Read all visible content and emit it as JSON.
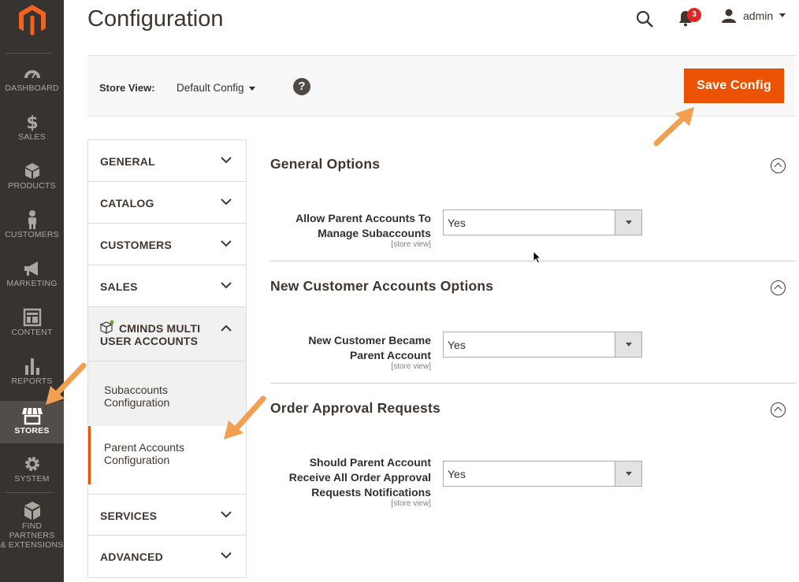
{
  "page": {
    "title": "Configuration"
  },
  "header": {
    "notifications_count": "3",
    "user_name": "admin"
  },
  "nav": {
    "items": [
      {
        "label": "DASHBOARD",
        "icon": "dashboard-icon"
      },
      {
        "label": "SALES",
        "icon": "dollar-icon"
      },
      {
        "label": "PRODUCTS",
        "icon": "box-icon"
      },
      {
        "label": "CUSTOMERS",
        "icon": "person-icon"
      },
      {
        "label": "MARKETING",
        "icon": "megaphone-icon"
      },
      {
        "label": "CONTENT",
        "icon": "content-icon"
      },
      {
        "label": "REPORTS",
        "icon": "bar-chart-icon"
      },
      {
        "label": "STORES",
        "icon": "store-icon",
        "active": true
      },
      {
        "label": "SYSTEM",
        "icon": "gear-icon"
      },
      {
        "label_line1": "FIND PARTNERS",
        "label_line2": "& EXTENSIONS",
        "icon": "blocks-icon"
      }
    ]
  },
  "store_view": {
    "label": "Store View:",
    "value": "Default Config"
  },
  "toolbar": {
    "save_label": "Save Config"
  },
  "tabs": {
    "general": "GENERAL",
    "catalog": "CATALOG",
    "customers": "CUSTOMERS",
    "sales": "SALES",
    "cminds_line1": "CMINDS MULTI",
    "cminds_line2": "USER ACCOUNTS",
    "sub_subaccounts_line1": "Subaccounts",
    "sub_subaccounts_line2": "Configuration",
    "sub_parent_line1": "Parent Accounts",
    "sub_parent_line2": "Configuration",
    "services": "SERVICES",
    "advanced": "ADVANCED"
  },
  "sections": [
    {
      "title": "General Options",
      "field_line1": "Allow Parent Accounts To",
      "field_line2": "Manage Subaccounts",
      "scope": "[store view]",
      "value": "Yes"
    },
    {
      "title": "New Customer Accounts Options",
      "field_line1": "New Customer Became",
      "field_line2": "Parent Account",
      "scope": "[store view]",
      "value": "Yes"
    },
    {
      "title": "Order Approval Requests",
      "field_line1": "Should Parent Account",
      "field_line2": "Receive All Order Approval",
      "field_line3": "Requests Notifications",
      "scope": "[store view]",
      "value": "Yes"
    }
  ],
  "colors": {
    "accent": "#eb5202",
    "nav_bg": "#373330",
    "annotation_arrow": "#f0a050"
  }
}
